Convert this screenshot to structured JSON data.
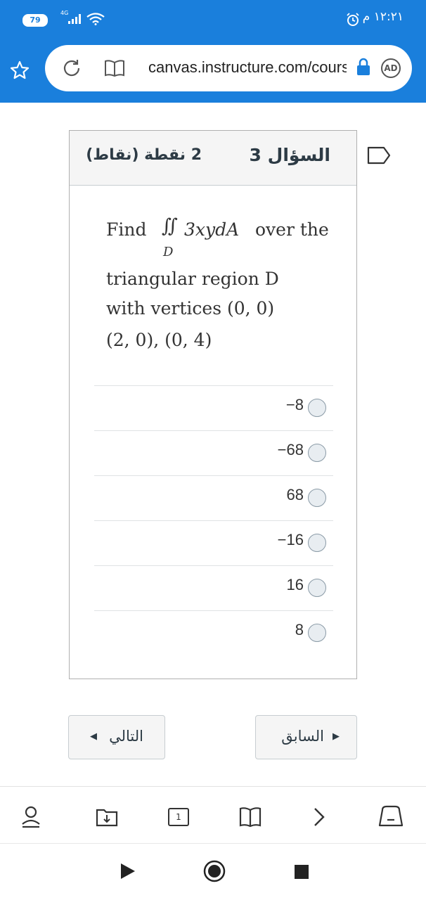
{
  "status_bar": {
    "battery": "79",
    "network": "4G",
    "time": "١٢:٢١ م"
  },
  "browser": {
    "url": "canvas.instructure.com/courses",
    "adblock_label": "AD"
  },
  "quiz": {
    "question_title": "السؤال 3",
    "points": "2 نقطة (نقاط)",
    "prompt_find": "Find",
    "prompt_integral": "∬",
    "prompt_integral_region": "D",
    "prompt_expr": "3xydA",
    "prompt_over": "over the",
    "prompt_line2": "triangular region D",
    "prompt_line3": "with vertices (0, 0)",
    "prompt_line4": "(2, 0), (0, 4)",
    "answers": [
      "−8",
      "−68",
      "68",
      "−16",
      "16",
      "8"
    ]
  },
  "navigation": {
    "next_label": "التالي",
    "prev_label": "السابق"
  },
  "bottom_toolbar": {
    "page_count": "1"
  },
  "colors": {
    "status_bar_bg": "#1a7fdc",
    "text_primary": "#2d3b45"
  }
}
